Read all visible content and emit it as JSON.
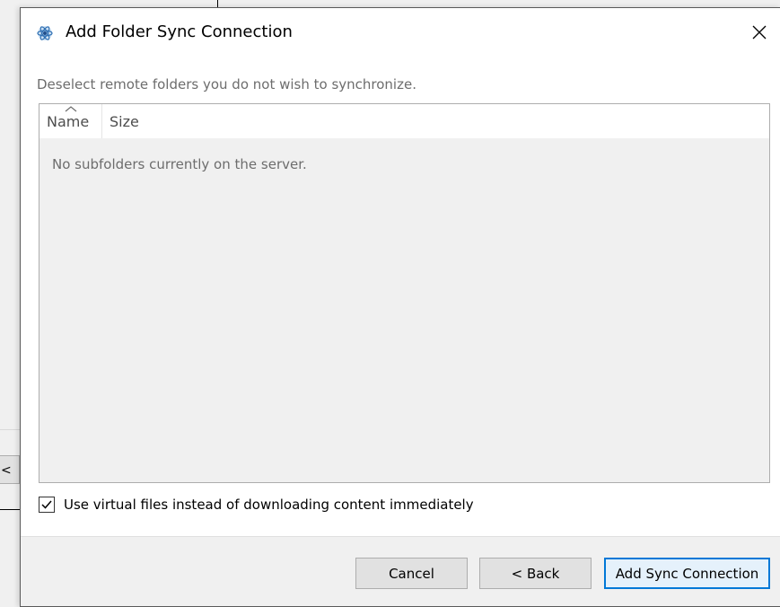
{
  "background": {
    "button_label": "< B"
  },
  "dialog": {
    "title": "Add Folder Sync Connection",
    "app_icon": "sync-app-icon",
    "close_icon": "close-icon"
  },
  "content": {
    "instruction": "Deselect remote folders you do not wish to synchronize.",
    "columns": [
      {
        "label": "Name",
        "sorted": true
      },
      {
        "label": "Size",
        "sorted": false
      }
    ],
    "empty_message": "No subfolders currently on the server."
  },
  "options": {
    "virtual_files_label": "Use virtual files instead of downloading content immediately",
    "virtual_files_checked": true
  },
  "buttons": {
    "cancel": "Cancel",
    "back": "< Back",
    "add": "Add Sync Connection"
  },
  "colors": {
    "accent": "#0078d7",
    "default_button_bg": "#e5f1fb"
  }
}
